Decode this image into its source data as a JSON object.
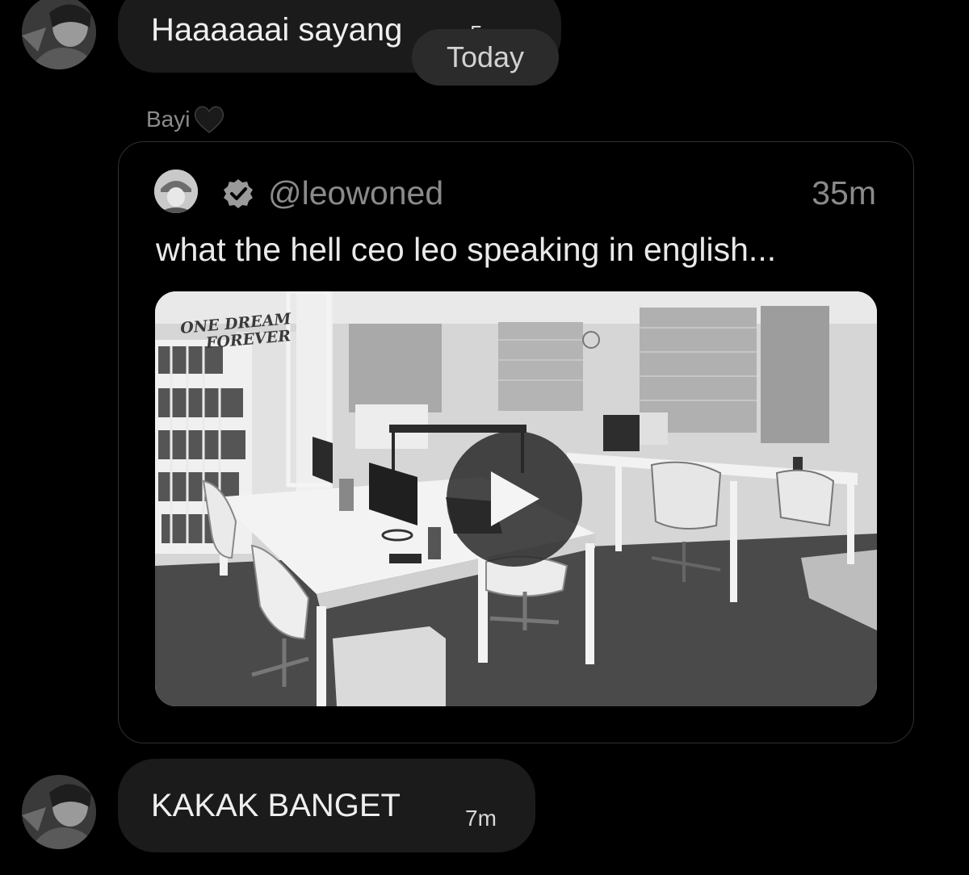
{
  "messages": [
    {
      "text": "Haaaaaai sayang",
      "time": "5m"
    },
    {
      "text": "KAKAK BANGET",
      "time": "7m"
    }
  ],
  "date_separator": "Today",
  "reply_sender": "Bayi",
  "reply_sender_emoji": "black-heart-icon",
  "quoted_post": {
    "handle": "@leowoned",
    "time": "35m",
    "text": "what the hell ceo leo speaking in english...",
    "media_logo_line1": "ONE DREAM",
    "media_logo_line2": "FOREVER"
  },
  "colors": {
    "background": "#000000",
    "bubble": "#1b1b1b",
    "date_pill": "#2b2b2b",
    "muted_text": "#8a8a8a"
  }
}
